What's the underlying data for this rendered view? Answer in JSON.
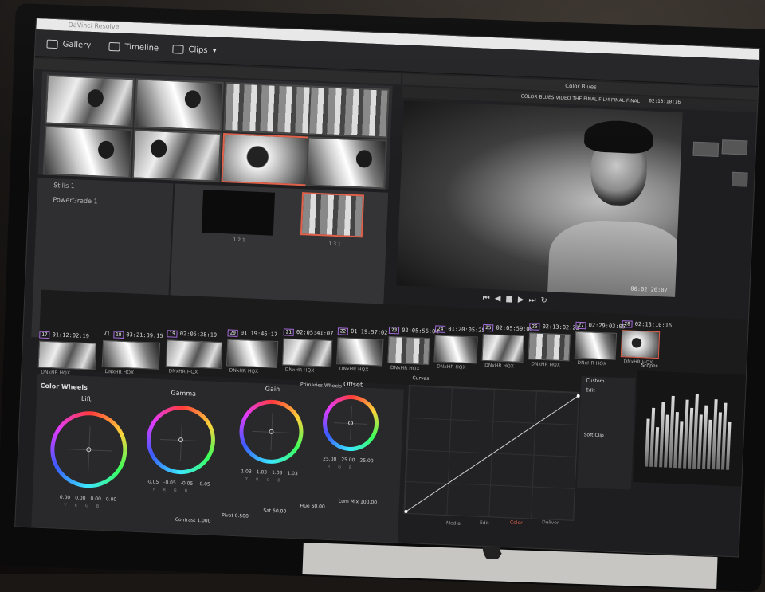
{
  "window": {
    "title": "DaVinci Resolve"
  },
  "topbar": {
    "gallery": "Gallery",
    "timeline": "Timeline",
    "clips": "Clips"
  },
  "viewer": {
    "panel_title": "Color Blues",
    "clip_title": "COLOR BLUES VIDEO THE FINAL FILM FINAL FINAL",
    "timecode": "00:02:26:07",
    "top_timecode": "02:13:10:16"
  },
  "gallery": {
    "albums": [
      "Stills 1",
      "PowerGrade 1"
    ],
    "stills": [
      {
        "label": "1.2.1"
      },
      {
        "label": "1.3.1"
      }
    ]
  },
  "clips": [
    {
      "tc": "01:12:02:19",
      "track": "V1",
      "num": "17",
      "codec": "DNxHR HQX"
    },
    {
      "tc": "03:21:39:15",
      "track": "V1",
      "num": "18",
      "codec": "DNxHR HQX"
    },
    {
      "tc": "02:05:38:10",
      "track": "V1",
      "num": "19",
      "codec": "DNxHR HQX"
    },
    {
      "tc": "01:19:46:17",
      "track": "V1",
      "num": "20",
      "codec": "DNxHR HQX"
    },
    {
      "tc": "02:05:41:07",
      "track": "V1",
      "num": "21",
      "codec": "DNxHR HQX"
    },
    {
      "tc": "01:19:57:02",
      "track": "V1",
      "num": "22",
      "codec": "DNxHR HQX"
    },
    {
      "tc": "02:05:56:04",
      "track": "V1",
      "num": "23",
      "codec": "DNxHR HQX"
    },
    {
      "tc": "01:20:05:25",
      "track": "V1",
      "num": "24",
      "codec": "DNxHR HQX"
    },
    {
      "tc": "02:05:59:05",
      "track": "V1",
      "num": "25",
      "codec": "DNxHR HQX"
    },
    {
      "tc": "02:13:02:23",
      "track": "V1",
      "num": "26",
      "codec": "DNxHR HQX"
    },
    {
      "tc": "02:29:03:05",
      "track": "V1",
      "num": "27",
      "codec": "DNxHR HQX"
    },
    {
      "tc": "02:13:10:16",
      "track": "V1",
      "num": "28",
      "codec": "DNxHR HQX"
    }
  ],
  "color": {
    "wheels_title": "Color Wheels",
    "primaries_title": "Primaries Wheels",
    "curves_title": "Curves",
    "lift": {
      "title": "Lift",
      "values": [
        "0.00",
        "0.00",
        "0.00",
        "0.00"
      ]
    },
    "gamma": {
      "title": "Gamma",
      "values": [
        "-0.05",
        "-0.05",
        "-0.05",
        "-0.05"
      ]
    },
    "gain": {
      "title": "Gain",
      "values": [
        "1.03",
        "1.03",
        "1.03",
        "1.03"
      ]
    },
    "offset": {
      "title": "Offset",
      "values": [
        "25.00",
        "25.00",
        "25.00"
      ]
    },
    "channels": [
      "Y",
      "R",
      "G",
      "B"
    ],
    "contrast_label": "Contrast",
    "contrast": "1.000",
    "pivot_label": "Pivot",
    "pivot": "0.500",
    "sat_label": "Sat",
    "sat": "50.00",
    "hue_label": "Hue",
    "hue": "50.00",
    "lum_mix_label": "Lum Mix",
    "lum_mix": "100.00"
  },
  "curves": {
    "custom_label": "Custom",
    "soft_clip": "Soft Clip",
    "edit": "Edit",
    "scopes_label": "Scopes"
  },
  "pages": [
    "Media",
    "Edit",
    "Color",
    "Deliver"
  ]
}
